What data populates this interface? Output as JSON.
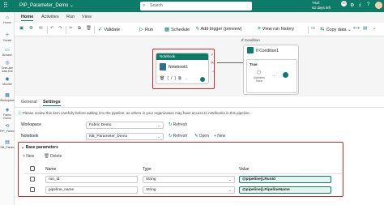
{
  "app": {
    "title": "PIP_Parameter_Demo",
    "title_caret": "⌄",
    "search_placeholder": "Search",
    "trial": [
      "Trial:",
      "62 days left"
    ],
    "notification_count": "40"
  },
  "rail": [
    {
      "icon": "home-icon",
      "label": "Home",
      "glyph": "⌂"
    },
    {
      "icon": "plus-icon",
      "label": "Create",
      "glyph": "＋"
    },
    {
      "icon": "browse-icon",
      "label": "Browse",
      "glyph": "▭"
    },
    {
      "icon": "onelake-icon",
      "label": "OneLake data hub",
      "glyph": "◎"
    },
    {
      "icon": "monitor-icon",
      "label": "Monitor",
      "glyph": "◉"
    },
    {
      "icon": "workspaces-icon",
      "label": "Workspaces",
      "glyph": "▦"
    },
    {
      "icon": "fabric-demo-icon",
      "label": "Fabric Demo",
      "glyph": "◈"
    },
    {
      "icon": "pipeline-icon",
      "label": "PIP_Param_Demo",
      "glyph": "⟲"
    },
    {
      "icon": "notebook-icon",
      "label": "NB_Param",
      "glyph": "▤"
    }
  ],
  "tabs": [
    "Home",
    "Activities",
    "Run",
    "View"
  ],
  "toolbar": {
    "validate": "Validate",
    "run": "Run",
    "schedule": "Schedule",
    "add_trigger": "Add trigger (preview)",
    "view_run_history": "View run history",
    "copy_data": "Copy data"
  },
  "canvas": {
    "notebook_header": "Notebook",
    "notebook_name": "Notebook1",
    "if_header": "If Condition",
    "if_name": "If Condition1",
    "true_label": "True",
    "inner_label": "Activities",
    "inner_sub": "None"
  },
  "props": {
    "tabs": [
      "General",
      "Settings"
    ],
    "notice": "Please review this item carefully before adding it to the pipeline, as others in your organization may have access to notebooks in this pipeline.",
    "workspace_label": "Workspace",
    "workspace_value": "Fabric Demo",
    "refresh_label": "Refresh",
    "notebook_label": "Notebook",
    "notebook_value": "NB_Parameter_Demo",
    "open_label": "Open",
    "new_label": "New",
    "base_parameters": "Base parameters",
    "new_button": "New",
    "delete_button": "Delete",
    "headers": [
      "Name",
      "Type",
      "Value"
    ],
    "rows": [
      {
        "name": "run_id",
        "type": "String",
        "value": "@pipeline().RunId"
      },
      {
        "name": "pipeline_name",
        "type": "String",
        "value": "@pipeline().PipelineName"
      }
    ]
  },
  "colors": {
    "accent": "#0e7a68",
    "highlight_border": "#d32a2a"
  }
}
